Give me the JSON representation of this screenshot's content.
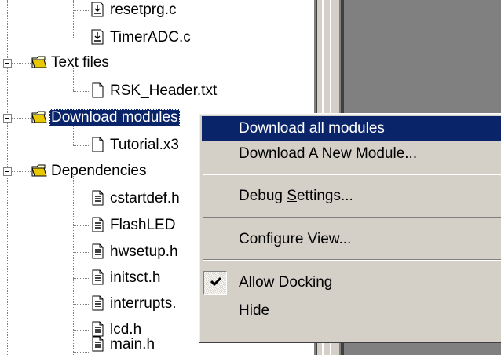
{
  "tree": {
    "items": [
      {
        "label": "resetprg.c",
        "icon": "c-source-file-icon"
      },
      {
        "label": "TimerADC.c",
        "icon": "c-source-file-icon"
      },
      {
        "label": "Text files",
        "icon": "folder-open-icon"
      },
      {
        "label": "RSK_Header.txt",
        "icon": "text-file-icon"
      },
      {
        "label": "Download modules",
        "icon": "folder-open-icon",
        "selected": true
      },
      {
        "label": "Tutorial.x3",
        "icon": "text-file-icon"
      },
      {
        "label": "Dependencies",
        "icon": "folder-open-icon"
      },
      {
        "label": "cstartdef.h",
        "icon": "header-file-icon"
      },
      {
        "label": "FlashLED",
        "icon": "header-file-icon"
      },
      {
        "label": "hwsetup.h",
        "icon": "header-file-icon"
      },
      {
        "label": "initsct.h",
        "icon": "header-file-icon"
      },
      {
        "label": "interrupts.",
        "icon": "header-file-icon"
      },
      {
        "label": "lcd.h",
        "icon": "header-file-icon"
      },
      {
        "label": "main.h",
        "icon": "header-file-icon"
      }
    ]
  },
  "context_menu": {
    "download_all": {
      "pre": "Download ",
      "u": "a",
      "post": "ll modules"
    },
    "download_new": {
      "pre": "Download A ",
      "u": "N",
      "post": "ew Module..."
    },
    "debug_settings": {
      "pre": "Debug ",
      "u": "S",
      "post": "ettings..."
    },
    "configure_view": {
      "label": "Configure View..."
    },
    "allow_docking": {
      "label": "Allow Docking",
      "checked": true
    },
    "hide": {
      "label": "Hide"
    }
  },
  "colors": {
    "selection": "#0a246a",
    "menu_face": "#d4d0c8",
    "workspace": "#808080"
  }
}
